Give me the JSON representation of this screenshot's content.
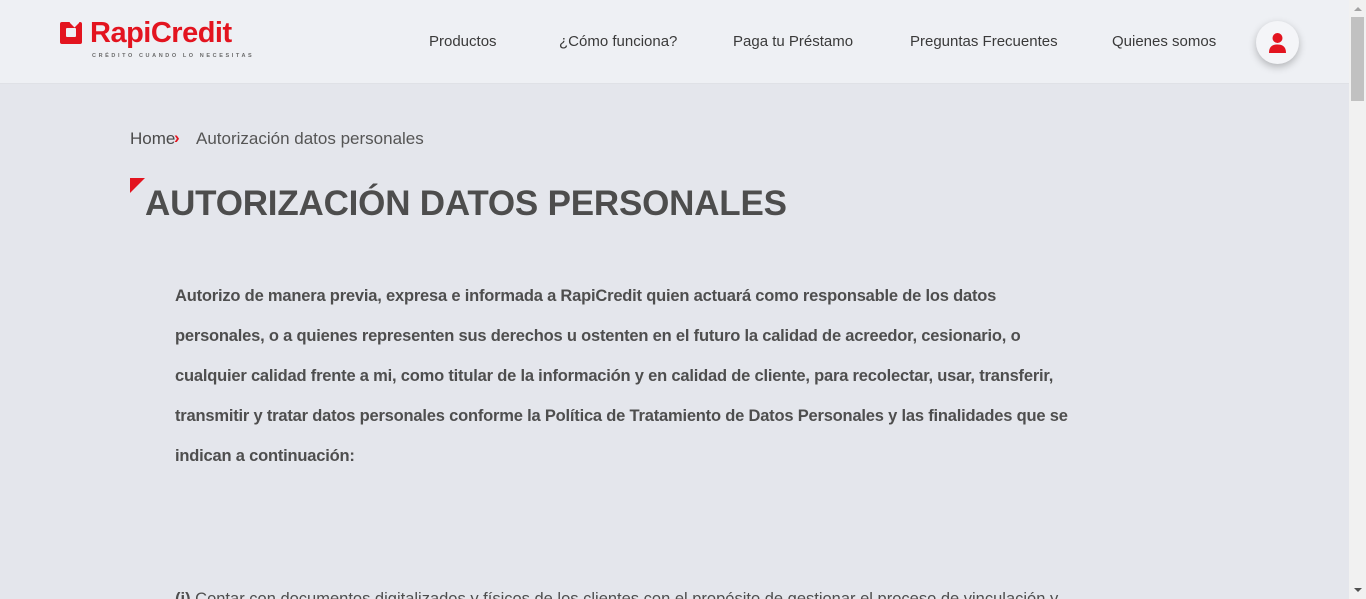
{
  "header": {
    "logo_text": "RapiCredit",
    "logo_tagline": "CRÉDITO CUANDO LO NECESITAS",
    "nav": [
      "Productos",
      "¿Cómo funciona?",
      "Paga tu Préstamo",
      "Preguntas Frecuentes",
      "Quienes somos"
    ],
    "user_icon": "user-icon"
  },
  "breadcrumb": {
    "home": "Home",
    "separator": "›",
    "current": "Autorización datos personales"
  },
  "page_title": "AUTORIZACIÓN DATOS PERSONALES",
  "content": {
    "intro": "Autorizo de manera previa, expresa e informada a RapiCredit quien actuará como responsable de los datos personales, o a quienes representen sus derechos u ostenten en el futuro la calidad de acreedor, cesionario, o cualquier calidad frente a mi, como titular de la información y en calidad de cliente, para  recolectar, usar, transferir, transmitir y tratar datos personales conforme la Política de Tratamiento de Datos Personales y  las finalidades que se indican a continuación:",
    "item_1_marker": "(i)",
    "item_1_text": " Contar con documentos digitalizados y físicos de los clientes con el propósito de  gestionar el proceso de vinculación y"
  },
  "colors": {
    "brand_red": "#e3141f",
    "background": "#e4e6ec",
    "text": "#4e4e4e"
  }
}
